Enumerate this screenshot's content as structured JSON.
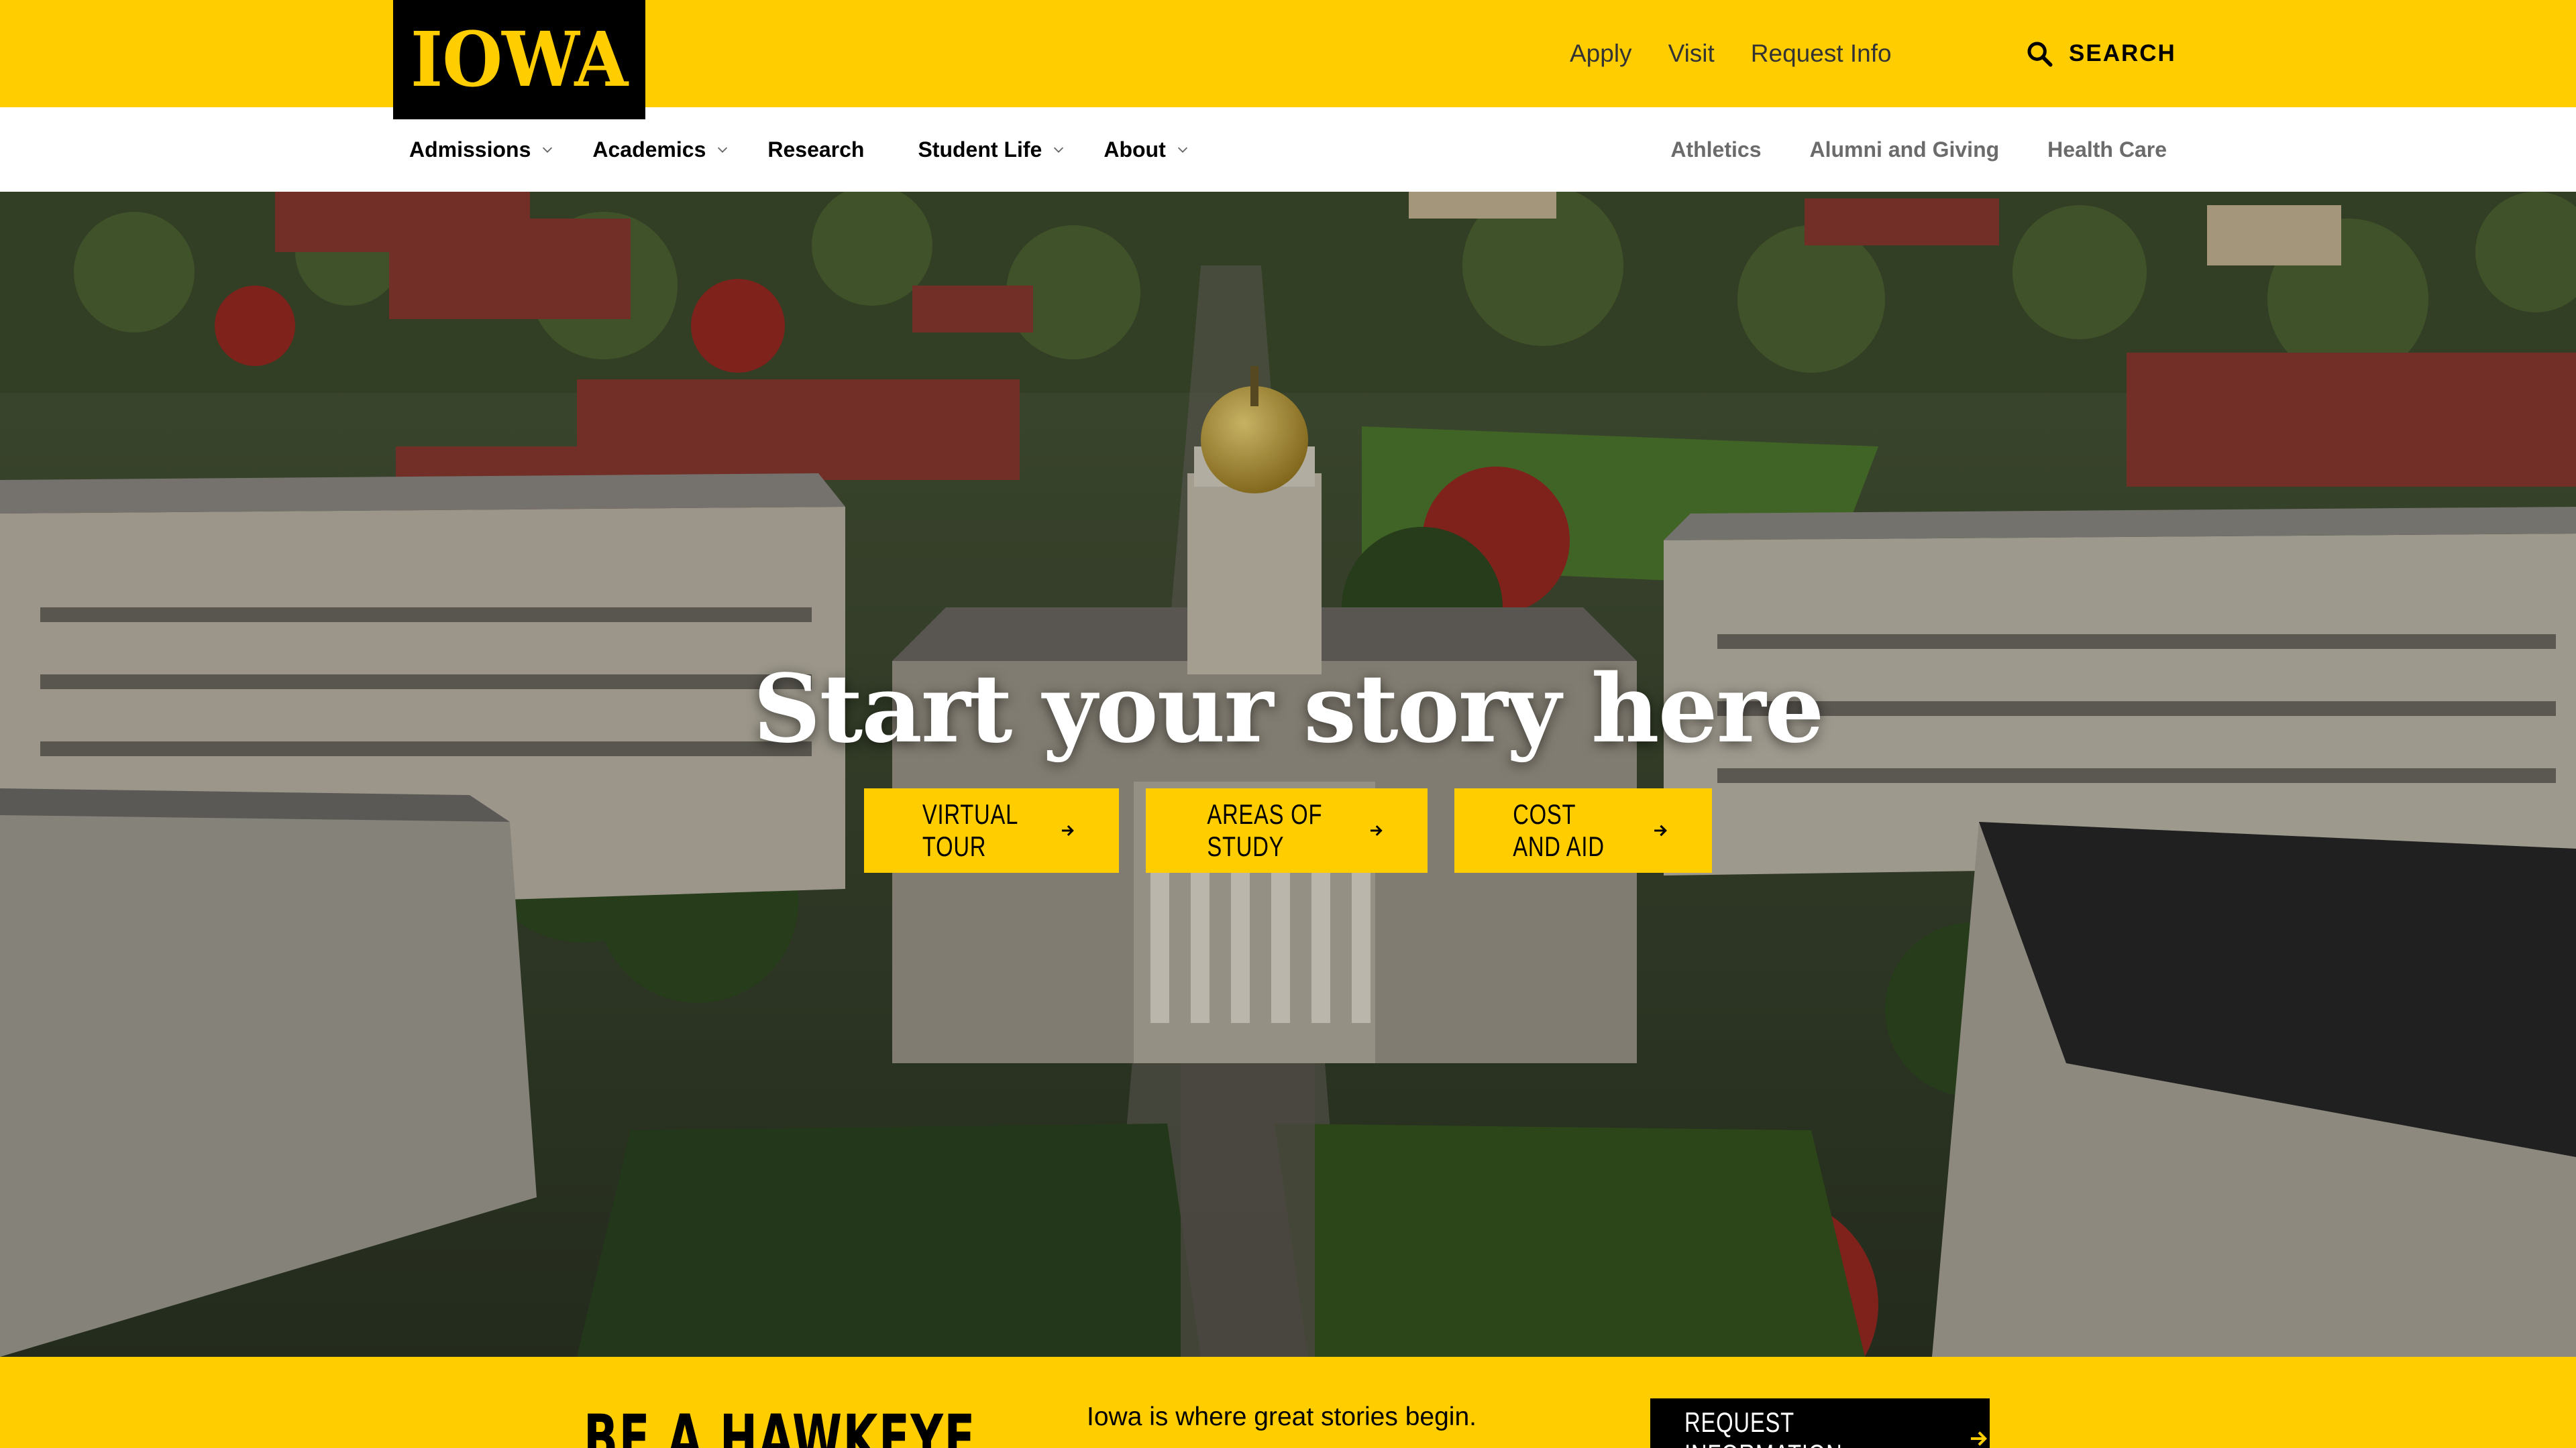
{
  "header": {
    "logo_text": "IOWA",
    "utility_links": [
      "Apply",
      "Visit",
      "Request Info"
    ],
    "search_label": "SEARCH"
  },
  "nav": {
    "main": [
      {
        "label": "Admissions",
        "has_dropdown": true
      },
      {
        "label": "Academics",
        "has_dropdown": true
      },
      {
        "label": "Research",
        "has_dropdown": false
      },
      {
        "label": "Student Life",
        "has_dropdown": true
      },
      {
        "label": "About",
        "has_dropdown": true
      }
    ],
    "secondary": [
      "Athletics",
      "Alumni and Giving",
      "Health Care"
    ]
  },
  "hero": {
    "title": "Start your story here",
    "buttons": [
      "VIRTUAL TOUR",
      "AREAS OF STUDY",
      "COST AND AID"
    ]
  },
  "band": {
    "heading": "BE A HAWKEYE",
    "text": "Iowa is where great stories begin.",
    "button": "REQUEST INFORMATION"
  },
  "colors": {
    "brand_gold": "#FFCD00",
    "black": "#000000",
    "nav_gray": "#6b6b6b"
  },
  "icons": {
    "search": "search-icon",
    "dropdown": "chevron-down-icon",
    "cta": "arrow-right-icon"
  }
}
